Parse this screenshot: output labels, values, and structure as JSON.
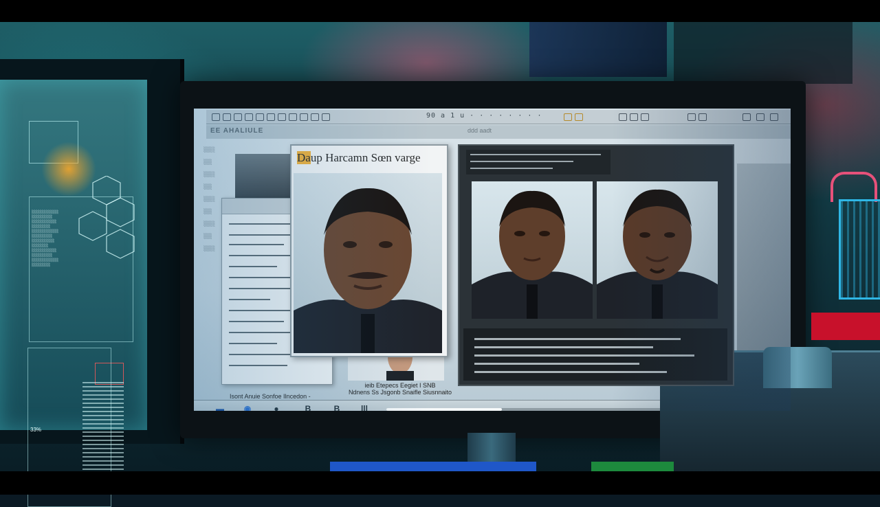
{
  "photo_window": {
    "title_highlight": "Da",
    "title_rest": "up Harcamn Sœn varge"
  },
  "captions": {
    "bottom_left": "Isont  Anuie Sonfoe  Ilncedon  -",
    "small_photo_line1": "ieib  Etepecs Eegiet  I SNB",
    "small_photo_line2": "Ndnens  Ss  Jsgonb  Snaifle  Siusnnaito"
  },
  "toolbar": {
    "text": "90 a  1 u   ·  ·  ·  ·  ·  ·  ·  ·"
  },
  "second_bar": {
    "label": "EE AHALIULE",
    "right_text": "ddd  aadt"
  },
  "holo": {
    "percent": "33%"
  },
  "taskbar": {
    "icons": [
      "B",
      "B",
      "|||"
    ],
    "progress": 0.42
  },
  "colors": {
    "title_highlight": "#f2b23a",
    "accent_cyan": "#2fb7e6",
    "red_led": "#ff3a3a"
  }
}
